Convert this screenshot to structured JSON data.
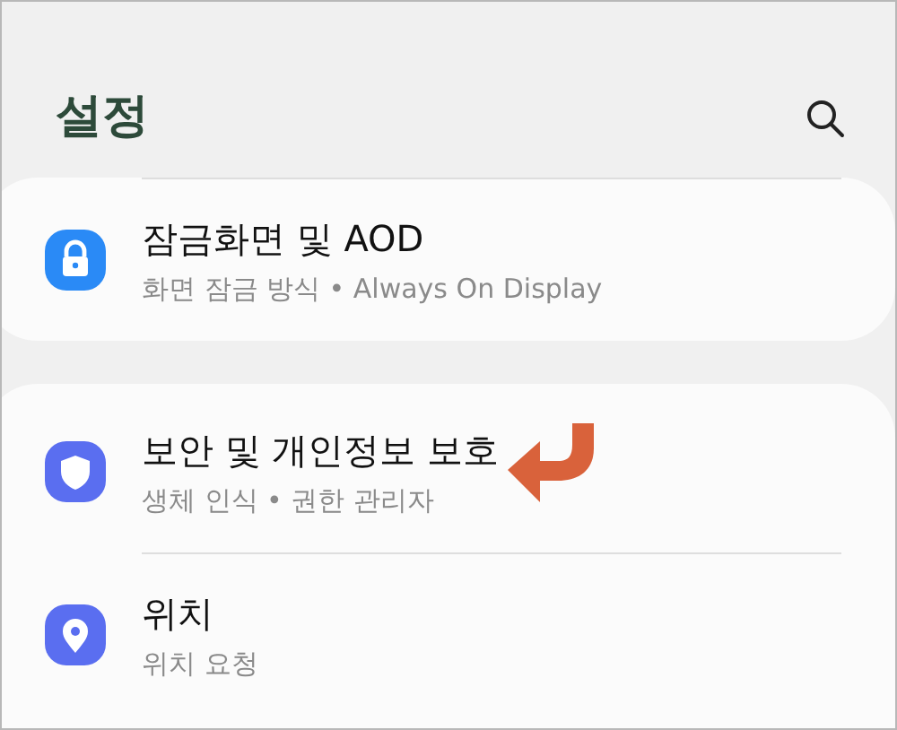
{
  "header": {
    "title": "설정"
  },
  "cards": [
    {
      "items": [
        {
          "kind": "lock",
          "color": "#2a8af6",
          "title": "잠금화면 및 AOD",
          "subtitle": "화면 잠금 방식 • Always On Display"
        }
      ]
    },
    {
      "items": [
        {
          "kind": "shield",
          "color": "#5a6ef0",
          "title": "보안 및 개인정보 보호",
          "subtitle": "생체 인식 • 권한 관리자"
        },
        {
          "kind": "pin",
          "color": "#5a6ef0",
          "title": "위치",
          "subtitle": "위치 요청"
        }
      ]
    }
  ]
}
